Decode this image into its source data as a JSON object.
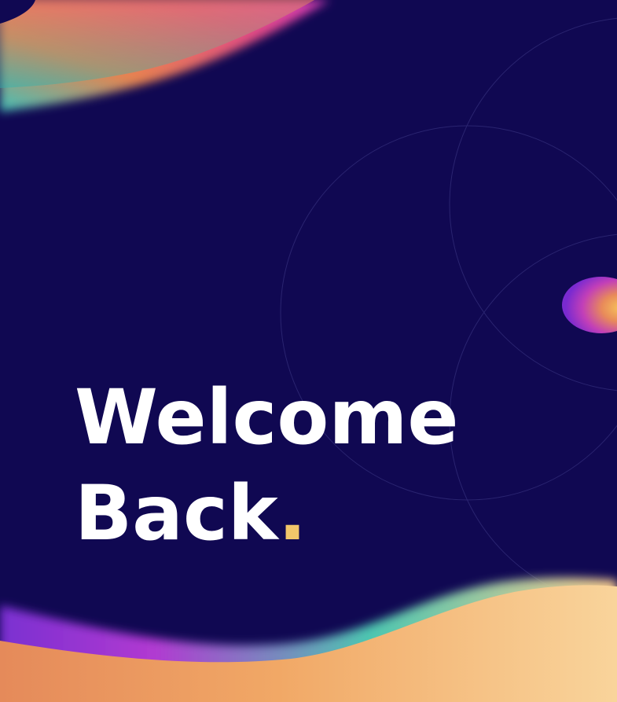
{
  "welcome": {
    "line1": "Welcome",
    "line2": "Back",
    "accent": "."
  },
  "colors": {
    "background": "#100852",
    "text": "#ffffff",
    "accent": "#f2c66a"
  }
}
